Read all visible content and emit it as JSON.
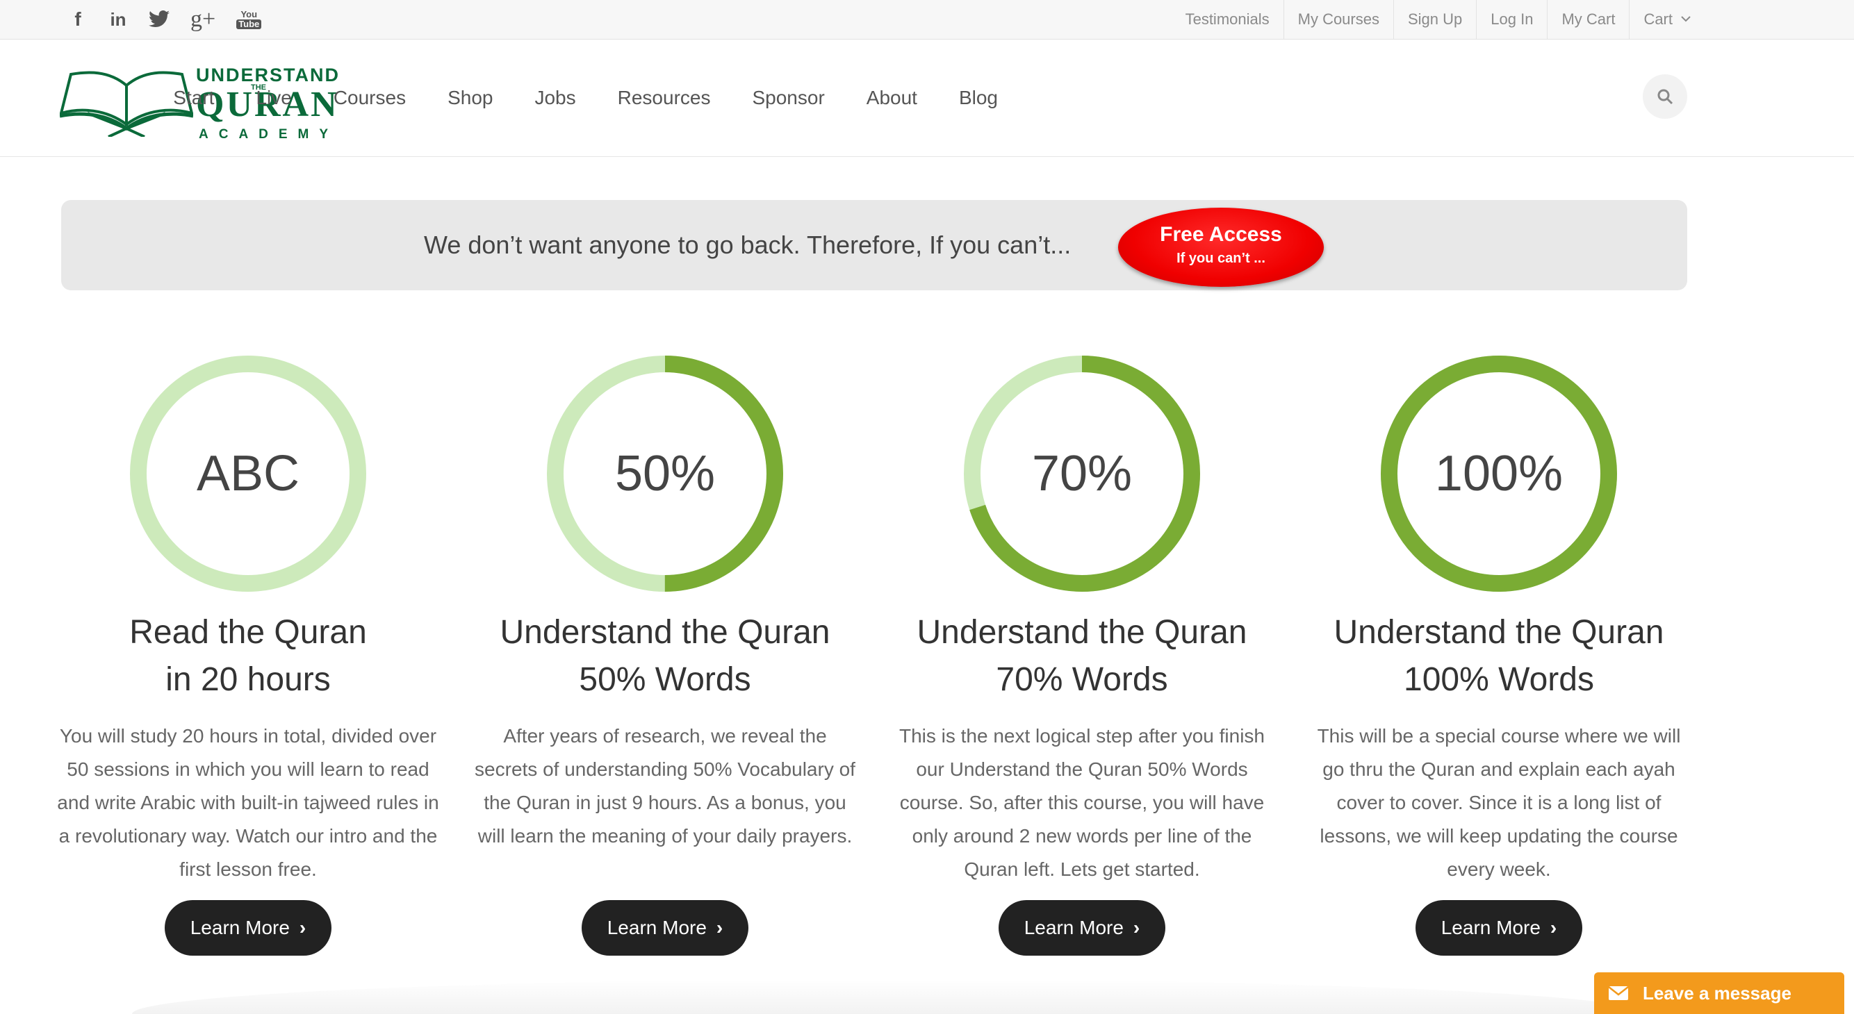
{
  "topbar": {
    "social": [
      {
        "icon": "facebook-icon",
        "glyph": "f"
      },
      {
        "icon": "linkedin-icon",
        "glyph": "in"
      },
      {
        "icon": "twitter-icon",
        "glyph": "🐦"
      },
      {
        "icon": "google-plus-icon",
        "glyph": "g+"
      },
      {
        "icon": "youtube-icon",
        "glyph_top": "You",
        "glyph_bottom": "Tube"
      }
    ],
    "links": [
      "Testimonials",
      "My Courses",
      "Sign Up",
      "Log In",
      "My Cart",
      "Cart"
    ]
  },
  "logo": {
    "line1": "UNDERSTAND",
    "line2": "THE",
    "line3": "QURAN",
    "line4": "ACADEMY"
  },
  "nav": [
    "Start",
    "Live",
    "Courses",
    "Shop",
    "Jobs",
    "Resources",
    "Sponsor",
    "About",
    "Blog"
  ],
  "banner": {
    "text": "We don’t want anyone to go back. Therefore, If you can’t...",
    "button_main": "Free Access",
    "button_sub": "If you can’t ..."
  },
  "courses": [
    {
      "ring_label": "ABC",
      "progress": 0,
      "title_line1": "Read the Quran",
      "title_line2": "in 20 hours",
      "description": "You will study 20 hours in total, divided over 50 sessions in which you will learn to read and write Arabic with built-in tajweed rules in a revolutionary way. Watch our intro and the first lesson free.",
      "button": "Learn More"
    },
    {
      "ring_label": "50%",
      "progress": 0.5,
      "title_line1": "Understand the Quran",
      "title_line2": "50% Words",
      "description": "After years of research, we reveal the secrets of understanding 50% Vocabulary of the Quran in just 9 hours. As a bonus, you will learn the meaning of your daily prayers.",
      "button": "Learn More"
    },
    {
      "ring_label": "70%",
      "progress": 0.7,
      "title_line1": "Understand the Quran",
      "title_line2": "70% Words",
      "description": "This is the next logical step after you finish our Understand the Quran 50% Words course. So, after this course, you will have only around 2 new words per line of the Quran left. Lets get started.",
      "button": "Learn More"
    },
    {
      "ring_label": "100%",
      "progress": 1.0,
      "title_line1": "Understand the Quran",
      "title_line2": "100% Words",
      "description": "This will be a special course where we will go thru the Quran and explain each ayah cover to cover. Since it is a long list of lessons, we will keep updating the course every week.",
      "button": "Learn More"
    }
  ],
  "chat": {
    "label": "Leave a message",
    "icon": "envelope-icon"
  },
  "colors": {
    "ring_track": "#cdeabb",
    "ring_fill": "#7aac34",
    "brand_green": "#0b6a3a",
    "cta_red": "#f00000",
    "chat_orange": "#f39a1c"
  }
}
